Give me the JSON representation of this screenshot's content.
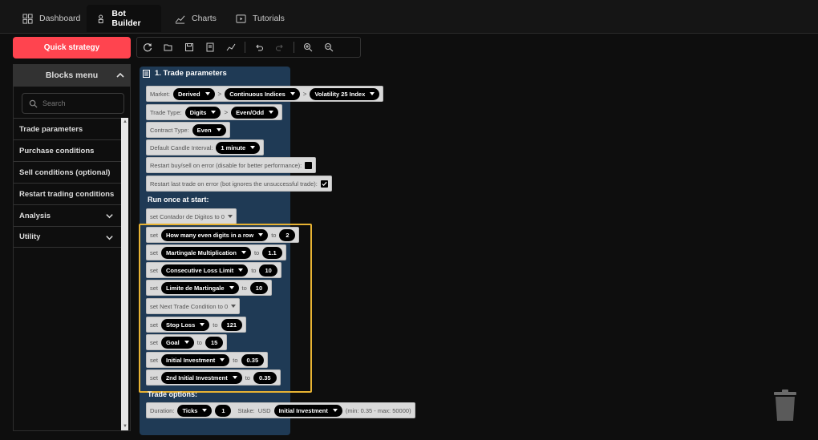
{
  "nav": {
    "tabs": [
      {
        "label": "Dashboard",
        "icon": "dashboard-icon"
      },
      {
        "label": "Bot Builder",
        "icon": "bot-builder-icon",
        "active": true
      },
      {
        "label": "Charts",
        "icon": "chart-icon"
      },
      {
        "label": "Tutorials",
        "icon": "tutorials-icon"
      }
    ]
  },
  "sidebar": {
    "quick_strategy": "Quick strategy",
    "blocks_menu": "Blocks menu",
    "search_placeholder": "Search",
    "items": [
      {
        "label": "Trade parameters",
        "expandable": false
      },
      {
        "label": "Purchase conditions",
        "expandable": false
      },
      {
        "label": "Sell conditions (optional)",
        "expandable": false
      },
      {
        "label": "Restart trading conditions",
        "expandable": false
      },
      {
        "label": "Analysis",
        "expandable": true
      },
      {
        "label": "Utility",
        "expandable": true
      }
    ]
  },
  "block": {
    "title": "1. Trade parameters",
    "market_label": "Market:",
    "market": [
      "Derived",
      "Continuous Indices",
      "Volatility 25 Index"
    ],
    "trade_type_label": "Trade Type:",
    "trade_type": [
      "Digits",
      "Even/Odd"
    ],
    "contract_type_label": "Contract Type:",
    "contract_type": "Even",
    "candle_label": "Default Candle Interval:",
    "candle": "1 minute",
    "restart_buy_label": "Restart buy/sell on error (disable for better performance):",
    "restart_buy_checked": false,
    "restart_last_label": "Restart last trade on error (bot ignores the unsuccessful trade):",
    "restart_last_checked": true,
    "run_once": "Run once at start:",
    "set_contador": "set Contador de Digitos to 0",
    "set_word": "set",
    "to_word": "to",
    "vars": [
      {
        "name": "How many even digits in a row",
        "value": "2"
      },
      {
        "name": "Martingale Multiplication",
        "value": "1.1"
      },
      {
        "name": "Consecutive Loss Limit",
        "value": "10"
      },
      {
        "name": "Limite de Martingale",
        "value": "10"
      }
    ],
    "set_next": "set Next Trade Condition to 0",
    "vars2": [
      {
        "name": "Stop Loss",
        "value": "121"
      },
      {
        "name": "Goal",
        "value": "15"
      },
      {
        "name": "Initial Investment",
        "value": "0.35"
      },
      {
        "name": "2nd Initial Investment",
        "value": "0.35"
      }
    ],
    "trade_options": "Trade options:",
    "duration_label": "Duration:",
    "duration_unit": "Ticks",
    "duration_value": "1",
    "stake_label": "Stake:",
    "currency": "USD",
    "stake_var": "Initial Investment",
    "stake_range": "(min: 0.35 - max: 50000)"
  },
  "colors": {
    "accent": "#ff444f",
    "highlight": "#e8b333",
    "block": "#1f3a55"
  }
}
